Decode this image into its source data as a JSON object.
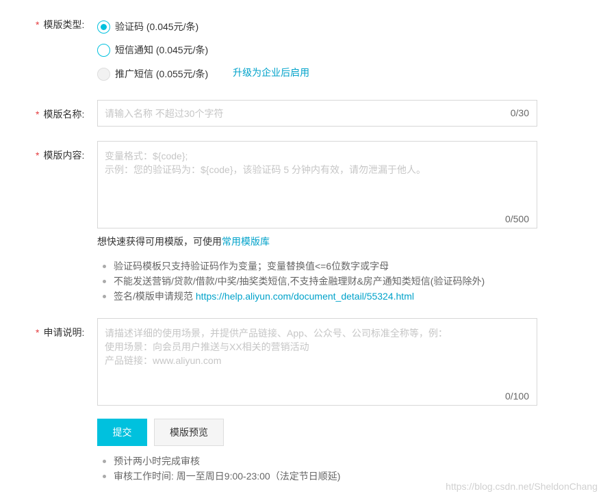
{
  "template_type": {
    "label": "模版类型:",
    "options": [
      {
        "text": "验证码 (0.045元/条)",
        "checked": true,
        "disabled": false
      },
      {
        "text": "短信通知 (0.045元/条)",
        "checked": false,
        "disabled": false
      },
      {
        "text": "推广短信 (0.055元/条)",
        "checked": false,
        "disabled": true
      }
    ],
    "upgrade_link": "升级为企业后启用"
  },
  "template_name": {
    "label": "模版名称:",
    "placeholder": "请输入名称 不超过30个字符",
    "counter": "0/30"
  },
  "template_content": {
    "label": "模版内容:",
    "placeholder": "变量格式：${code};\n 示例：您的验证码为：${code}，该验证码 5 分钟内有效，请勿泄漏于他人。",
    "counter": "0/500",
    "quick_hint": "想快速获得可用模版，可使用",
    "quick_link": "常用模版库",
    "rules": [
      "验证码模板只支持验证码作为变量；变量替换值<=6位数字或字母",
      "不能发送营销/贷款/借款/中奖/抽奖类短信,不支持金融理财&房产通知类短信(验证码除外)",
      "签名/模版申请规范"
    ],
    "rules_link": "https://help.aliyun.com/document_detail/55324.html"
  },
  "application_note": {
    "label": "申请说明:",
    "placeholder": "请描述详细的使用场景，并提供产品链接、App、公众号、公司标准全称等，例：\n使用场景：向会员用户推送与XX相关的营销活动\n产品链接：www.aliyun.com",
    "counter": "0/100"
  },
  "actions": {
    "submit": "提交",
    "preview": "模版预览"
  },
  "footer_notes": [
    "预计两小时完成审核",
    "审核工作时间: 周一至周日9:00-23:00（法定节日顺延)"
  ],
  "watermark": "https://blog.csdn.net/SheldonChang",
  "colors": {
    "accent": "#00c1de",
    "link": "#00a2ca",
    "required": "#e4393c",
    "placeholder": "#c6c6c6"
  }
}
